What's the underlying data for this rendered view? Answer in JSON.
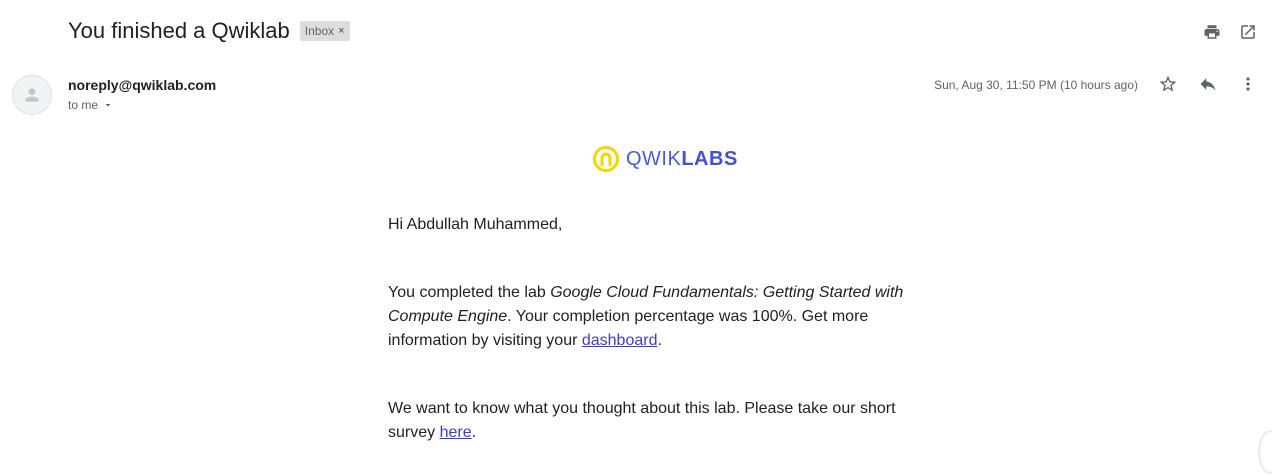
{
  "email": {
    "subject": "You finished a Qwiklab",
    "label": "Inbox",
    "label_remove": "×",
    "sender": "noreply@qwiklab.com",
    "recipient": "to me",
    "timestamp": "Sun, Aug 30, 11:50 PM (10 hours ago)"
  },
  "icons": {
    "print": "print-icon",
    "open_new_window": "open-in-new-icon",
    "star": "star-icon",
    "reply": "reply-icon",
    "more": "more-vert-icon",
    "avatar": "person-icon",
    "dropdown": "caret-down-icon"
  },
  "body": {
    "logo_light": "QWIK",
    "logo_bold": "LABS",
    "greeting": "Hi Abdullah Muhammed,",
    "p1_before": "You completed the lab ",
    "p1_lab": "Google Cloud Fundamentals: Getting Started with Compute Engine",
    "p1_middle": ". Your completion percentage was 100%. Get more information by visiting your ",
    "p1_link": "dashboard",
    "p1_end": ".",
    "p2_before": "We want to know what you thought about this lab. Please take our short survey ",
    "p2_link": "here",
    "p2_end": "."
  },
  "colors": {
    "logo_ring": "#f5d600",
    "logo_text": "#3f51d4",
    "link": "#3c3cd0",
    "label_bg": "#dddddd"
  }
}
